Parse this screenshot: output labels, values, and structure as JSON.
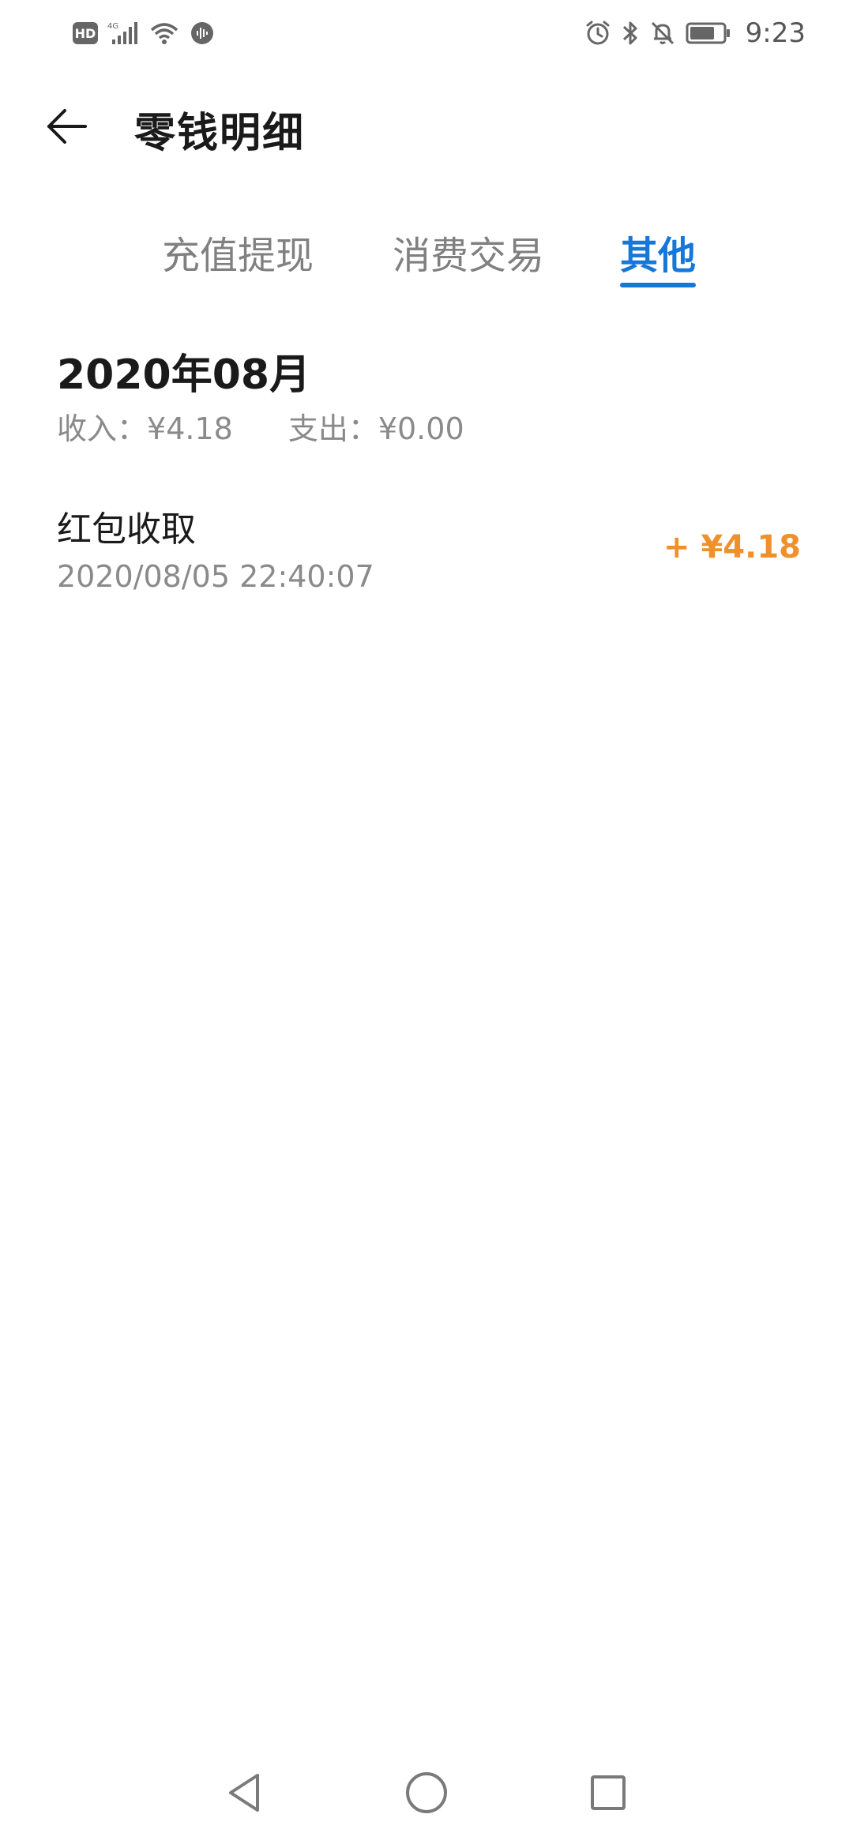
{
  "status_bar": {
    "hd_label": "HD",
    "network_label": "4G",
    "time": "9:23",
    "icons": [
      "hd-icon",
      "signal-icon",
      "wifi-icon",
      "voice-icon",
      "alarm-icon",
      "bluetooth-icon",
      "bell-off-icon",
      "battery-icon"
    ]
  },
  "header": {
    "title": "零钱明细",
    "back_icon": "arrow-left-icon"
  },
  "tabs": [
    {
      "label": "充值提现",
      "active": false
    },
    {
      "label": "消费交易",
      "active": false
    },
    {
      "label": "其他",
      "active": true
    }
  ],
  "summary": {
    "month": "2020年08月",
    "income_label": "收入：",
    "income_value": "¥4.18",
    "expense_label": "支出：",
    "expense_value": "¥0.00"
  },
  "transactions": [
    {
      "name": "红包收取",
      "time": "2020/08/05 22:40:07",
      "amount": "+ ¥4.18"
    }
  ],
  "colors": {
    "accent": "#1677d8",
    "amount_positive": "#f0902d",
    "secondary_text": "#8a8a8a"
  },
  "nav": {
    "icons": [
      "back-triangle-icon",
      "home-circle-icon",
      "recents-square-icon"
    ]
  }
}
